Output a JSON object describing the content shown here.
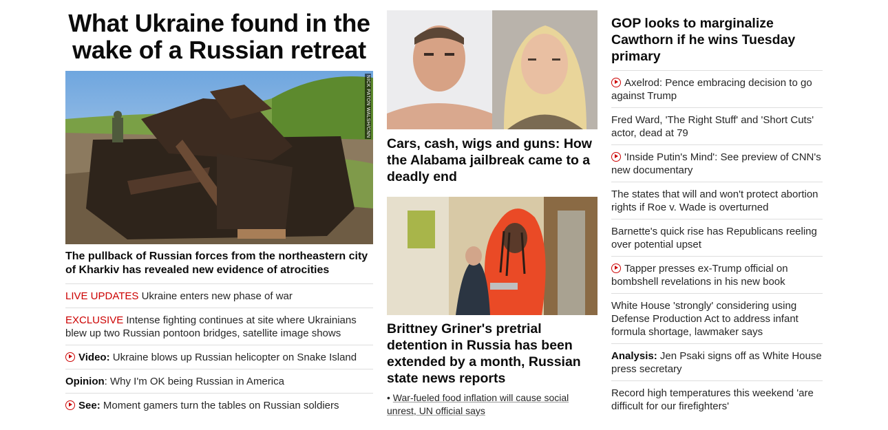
{
  "left": {
    "headline": "What Ukraine found in the wake of a Russian retreat",
    "image_credit": "NICK PATON WALSH/CNN",
    "caption": "The pullback of Russian forces from the northeastern city of Kharkiv has revealed new evidence of atrocities",
    "items": [
      {
        "label": "LIVE UPDATES",
        "text": " Ukraine enters new phase of war"
      },
      {
        "label": "EXCLUSIVE",
        "text": " Intense fighting continues at site where Ukrainians blew up two Russian pontoon bridges, satellite image shows"
      },
      {
        "label": "Video:",
        "text": " Ukraine blows up Russian helicopter on Snake Island"
      },
      {
        "label": "Opinion",
        "text": ": Why I'm OK being Russian in America"
      },
      {
        "label": "See:",
        "text": " Moment gamers turn the tables on Russian soldiers"
      }
    ]
  },
  "middle": {
    "story1_headline": "Cars, cash, wigs and guns: How the Alabama jailbreak came to a deadly end",
    "story2_headline": "Brittney Griner's pretrial detention in Russia has been extended by a month, Russian state news reports",
    "bullet_prefix": "• ",
    "bullet_text": "War-fueled food inflation will cause social unrest, UN official says"
  },
  "right": {
    "headline": "GOP looks to marginalize Cawthorn if he wins Tuesday primary",
    "items": [
      {
        "text": "Axelrod: Pence embracing decision to go against Trump"
      },
      {
        "text": "Fred Ward, 'The Right Stuff' and 'Short Cuts' actor, dead at 79"
      },
      {
        "text": "'Inside Putin's Mind': See preview of CNN's new documentary"
      },
      {
        "text": "The states that will and won't protect abortion rights if Roe v. Wade is overturned"
      },
      {
        "text": "Barnette's quick rise has Republicans reeling over potential upset"
      },
      {
        "text": "Tapper presses ex-Trump official on bombshell revelations in his new book"
      },
      {
        "text": "White House 'strongly' considering using Defense Production Act to address infant formula shortage, lawmaker says"
      },
      {
        "label": "Analysis:",
        "text": " Jen Psaki signs off as White House press secretary"
      },
      {
        "text": "Record high temperatures this weekend 'are difficult for our firefighters'"
      }
    ]
  },
  "colors": {
    "accent_red": "#cc0000",
    "divider": "#dddddd",
    "text": "#0c0c0c"
  }
}
